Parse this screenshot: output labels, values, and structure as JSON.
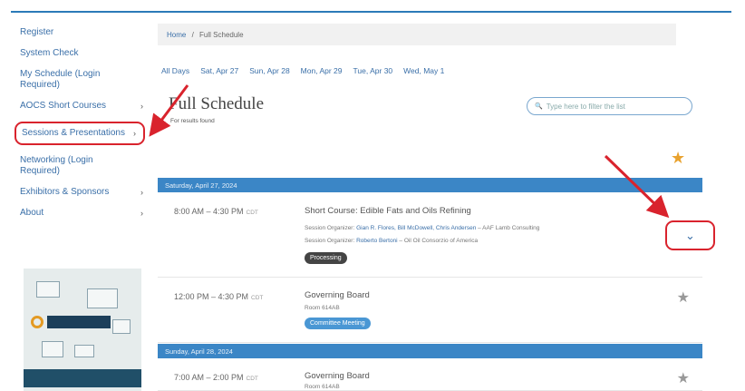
{
  "sidebar": {
    "items": [
      {
        "label": "Register",
        "has_arrow": false
      },
      {
        "label": "System Check",
        "has_arrow": false
      },
      {
        "label": "My Schedule (Login Required)",
        "has_arrow": false
      },
      {
        "label": "AOCS Short Courses",
        "has_arrow": true
      },
      {
        "label": "Sessions & Presentations",
        "has_arrow": true
      },
      {
        "label": "Networking (Login Required)",
        "has_arrow": false
      },
      {
        "label": "Exhibitors & Sponsors",
        "has_arrow": true
      },
      {
        "label": "About",
        "has_arrow": true
      }
    ]
  },
  "breadcrumb": {
    "home": "Home",
    "sep": "/",
    "current": "Full Schedule"
  },
  "day_tabs": [
    "All Days",
    "Sat, Apr 27",
    "Sun, Apr 28",
    "Mon, Apr 29",
    "Tue, Apr 30",
    "Wed, May 1"
  ],
  "page": {
    "title": "Full Schedule",
    "subtitle": "For results found"
  },
  "search": {
    "placeholder": "Type here to filter the list"
  },
  "days": [
    {
      "label": "Saturday, April 27, 2024"
    },
    {
      "label": "Sunday, April 28, 2024"
    }
  ],
  "sessions": [
    {
      "time": "8:00 AM – 4:30 PM",
      "tz": "CDT",
      "title": "Short Course: Edible Fats and Oils Refining",
      "meta1_prefix": "Session Organizer:",
      "meta1_names": "Gian R. Flores, Bill McDowell, Chris Andersen",
      "meta1_suffix": " – AAF Lamb Consulting",
      "meta2_prefix": "Session Organizer:",
      "meta2_names": "Roberto Bertoni",
      "meta2_suffix": " – Oil Oil Consorzio of America",
      "tag": "Processing"
    },
    {
      "time": "12:00 PM – 4:30 PM",
      "tz": "CDT",
      "title": "Governing Board",
      "meta1_prefix": "Room 614AB",
      "tag": "Committee Meeting"
    },
    {
      "time": "7:00 AM – 2:00 PM",
      "tz": "CDT",
      "title": "Governing Board",
      "meta1_prefix": "Room 614AB"
    }
  ],
  "icons": {
    "star": "★",
    "chevron": "⌄",
    "arrow": "›",
    "search": "🔍"
  },
  "colors": {
    "accent": "#3b86c6",
    "highlight": "#d9232d",
    "star_active": "#e9a22e"
  }
}
